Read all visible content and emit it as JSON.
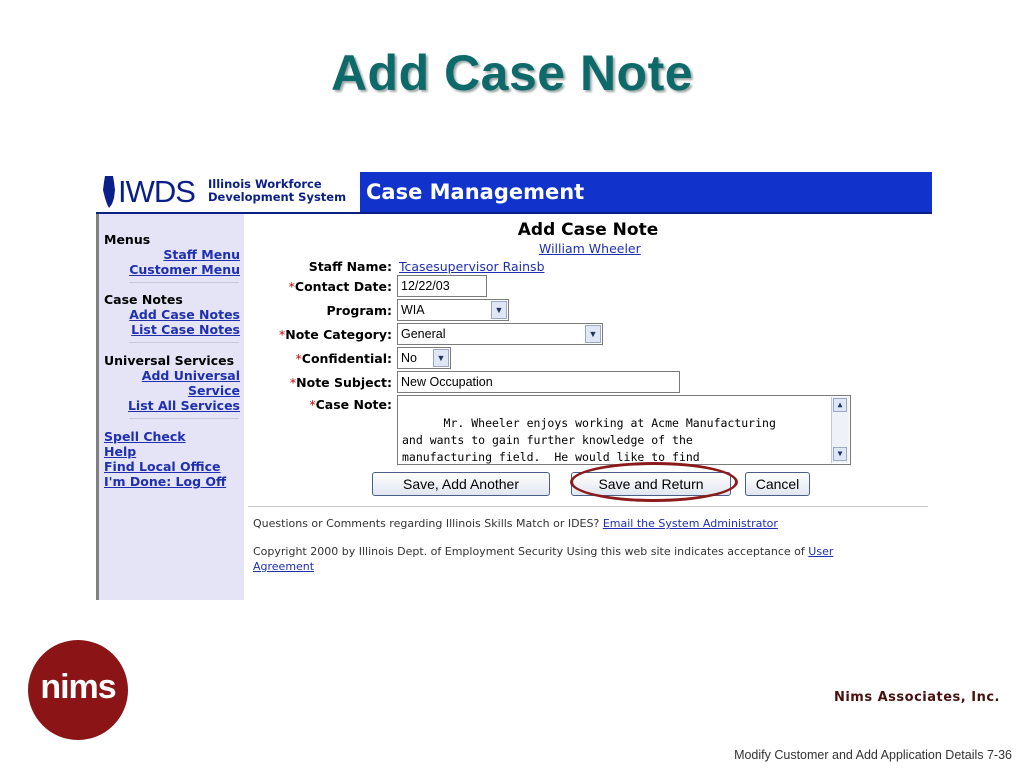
{
  "slide": {
    "title": "Add Case Note",
    "company": "Nims Associates, Inc.",
    "logo_text": "nims",
    "footer": "Modify Customer and Add Application Details 7-36"
  },
  "banner": {
    "logo": "IWDS",
    "org_line1": "Illinois Workforce",
    "org_line2": "Development System",
    "app": "Case Management"
  },
  "sidebar": {
    "menus_head": "Menus",
    "staff_menu": "Staff Menu",
    "customer_menu": "Customer Menu",
    "case_notes_head": "Case Notes",
    "add_case_notes": "Add Case Notes",
    "list_case_notes": "List Case Notes",
    "universal_head": "Universal Services",
    "add_universal_1": "Add Universal",
    "add_universal_2": "Service",
    "list_all_services": "List All Services",
    "spell_check": "Spell Check",
    "help": "Help",
    "find_local_office": "Find Local Office",
    "done": "I'm Done: Log Off"
  },
  "form": {
    "title": "Add Case Note",
    "customer_link": "William Wheeler",
    "staff_name_label": "Staff Name:",
    "staff_name_value": "Tcasesupervisor Rainsb",
    "required_marker": "*",
    "contact_date_label": "Contact Date:",
    "contact_date_value": "12/22/03",
    "program_label": "Program:",
    "program_value": "WIA",
    "note_category_label": "Note Category:",
    "note_category_value": "General",
    "confidential_label": "Confidential:",
    "confidential_value": "No",
    "note_subject_label": "Note Subject:",
    "note_subject_value": "New Occupation",
    "case_note_label": "Case Note:",
    "case_note_value": "Mr. Wheeler enjoys working at Acme Manufacturing\nand wants to gain further knowledge of the\nmanufacturing field.  He would like to find\ntraining programs that might help him.",
    "btn_save_add": "Save, Add Another",
    "btn_save_return": "Save and Return",
    "btn_cancel": "Cancel"
  },
  "footer": {
    "questions": "Questions or Comments regarding Illinois Skills Match or IDES?",
    "email_link": "Email the System Administrator",
    "copyright": "Copyright 2000 by Illinois Dept. of Employment Security Using this web site indicates acceptance of",
    "agreement_link_1": "User",
    "agreement_link_2": "Agreement"
  },
  "colors": {
    "title": "#0e6a6a",
    "banner": "#1133cc",
    "sidebar": "#e4e4f6",
    "link": "#1f2fb0",
    "required": "#cc0000",
    "highlight": "#8b1a1a",
    "logo": "#8b1416"
  },
  "icons": {
    "state": "illinois-state-icon",
    "dropdown": "chevron-down-icon"
  }
}
